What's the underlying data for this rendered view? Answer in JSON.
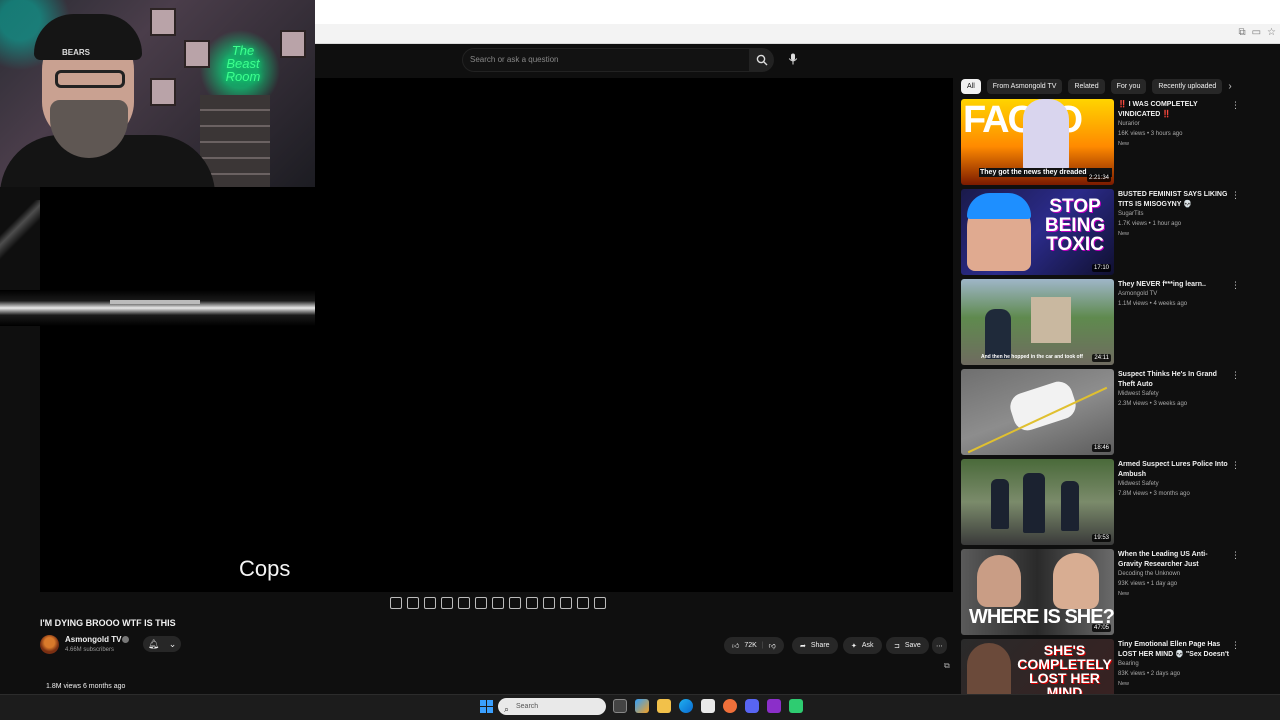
{
  "search": {
    "placeholder": "Search or ask a question"
  },
  "webcam": {
    "neon_sign": "The Beast Room",
    "cap_text": "BEARS"
  },
  "player": {
    "caption": "Cops"
  },
  "video": {
    "title": "I'M DYING BROOO WTF IS THIS",
    "channel": "Asmongold TV",
    "subscribers": "4.66M subscribers",
    "likes": "72K",
    "share_label": "Share",
    "ask_label": "Ask",
    "save_label": "Save",
    "views_date": "1.8M views  6 months ago"
  },
  "chips": [
    "All",
    "From Asmongold TV",
    "Related",
    "For you",
    "Recently uploaded"
  ],
  "recommendations": [
    {
      "title": "‼️ I WAS COMPLETELY VINDICATED ‼️",
      "channel": "Nurarior",
      "meta": "16K views • 3 hours ago",
      "badge": "New",
      "duration": "2:21:34",
      "thumb_text": "FACTO",
      "thumb_sub": "They got the news they dreaded"
    },
    {
      "title": "BUSTED FEMINIST SAYS LIKING TITS IS MISOGYNY 💀",
      "channel": "SugarTits",
      "meta": "1.7K views • 1 hour ago",
      "badge": "New",
      "duration": "17:10",
      "thumb_text": "STOP BEING TOXIC"
    },
    {
      "title": "They NEVER f***ing learn..",
      "channel": "Asmongold TV",
      "meta": "1.1M views • 4 weeks ago",
      "badge": "",
      "duration": "24:11",
      "thumb_sub": "And then he hopped in the car and took off"
    },
    {
      "title": "Suspect Thinks He's In Grand Theft Auto",
      "channel": "Midwest Safety",
      "meta": "2.3M views • 3 weeks ago",
      "badge": "",
      "duration": "18:46"
    },
    {
      "title": "Armed Suspect Lures Police Into Ambush",
      "channel": "Midwest Safety",
      "meta": "7.8M views • 3 months ago",
      "badge": "",
      "duration": "19:53"
    },
    {
      "title": "When the Leading US Anti-Gravity Researcher Just Disappeared",
      "channel": "Decoding the Unknown",
      "meta": "93K views • 1 day ago",
      "badge": "New",
      "duration": "47:05",
      "thumb_text": "WHERE IS SHE?"
    },
    {
      "title": "Tiny Emotional Ellen Page Has LOST HER MIND 💀 \"Sex Doesn't ...",
      "channel": "Bearing",
      "meta": "83K views • 2 days ago",
      "badge": "New",
      "duration": "",
      "thumb_text": "SHE'S COMPLETELY LOST HER MIND"
    }
  ],
  "taskbar": {
    "search_placeholder": "Search"
  },
  "colors": {
    "bg": "#0f0f0f",
    "pill": "#272727",
    "accent": "#3ea6ff"
  }
}
